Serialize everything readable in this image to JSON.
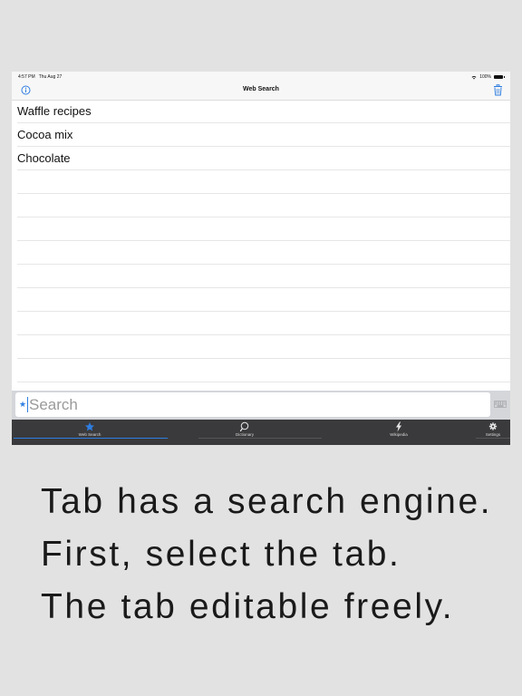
{
  "status_bar": {
    "time": "4:57 PM",
    "date": "Thu Aug 27",
    "battery": "100%"
  },
  "nav": {
    "title": "Web Search"
  },
  "history": [
    "Waffle recipes",
    "Cocoa mix",
    "Chocolate"
  ],
  "search": {
    "placeholder": "Search",
    "value": ""
  },
  "tabs": [
    "Web Search",
    "Dictionary",
    "Wikipedia",
    "Settings"
  ],
  "caption": [
    "Tab has a search engine.",
    "First, select the tab.",
    "The tab editable freely."
  ],
  "colors": {
    "accent": "#2e7de1",
    "tab_bar": "#3a3a3c",
    "background": "#e2e2e2"
  }
}
